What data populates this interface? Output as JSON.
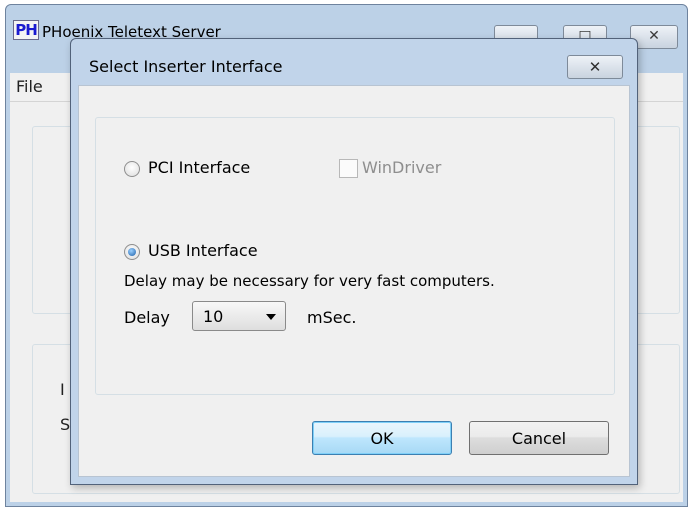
{
  "main_window": {
    "title": "PHoenix Teletext Server",
    "logo_text": "PH",
    "menu": {
      "file_label": "File"
    },
    "partial_labels": [
      "I",
      "S"
    ]
  },
  "dialog": {
    "title": "Select Inserter Interface",
    "close_glyph": "✕",
    "pci": {
      "label": "PCI Interface",
      "selected": false
    },
    "windriver": {
      "label": "WinDriver",
      "checked": false,
      "enabled": false
    },
    "usb": {
      "label": "USB Interface",
      "selected": true
    },
    "note": "Delay may be necessary for very fast computers.",
    "delay": {
      "label": "Delay",
      "value": "10",
      "unit": "mSec."
    },
    "ok_label": "OK",
    "cancel_label": "Cancel"
  },
  "colors": {
    "title_bar": "#bcd1e7",
    "dialog_frame": "#c1d4ea",
    "client": "#f0f0f0",
    "default_button_border": "#3c7fb1"
  },
  "icons": {
    "minimize": "minimize-icon",
    "maximize": "maximize-icon",
    "close": "close-icon",
    "dropdown": "chevron-down-icon"
  }
}
